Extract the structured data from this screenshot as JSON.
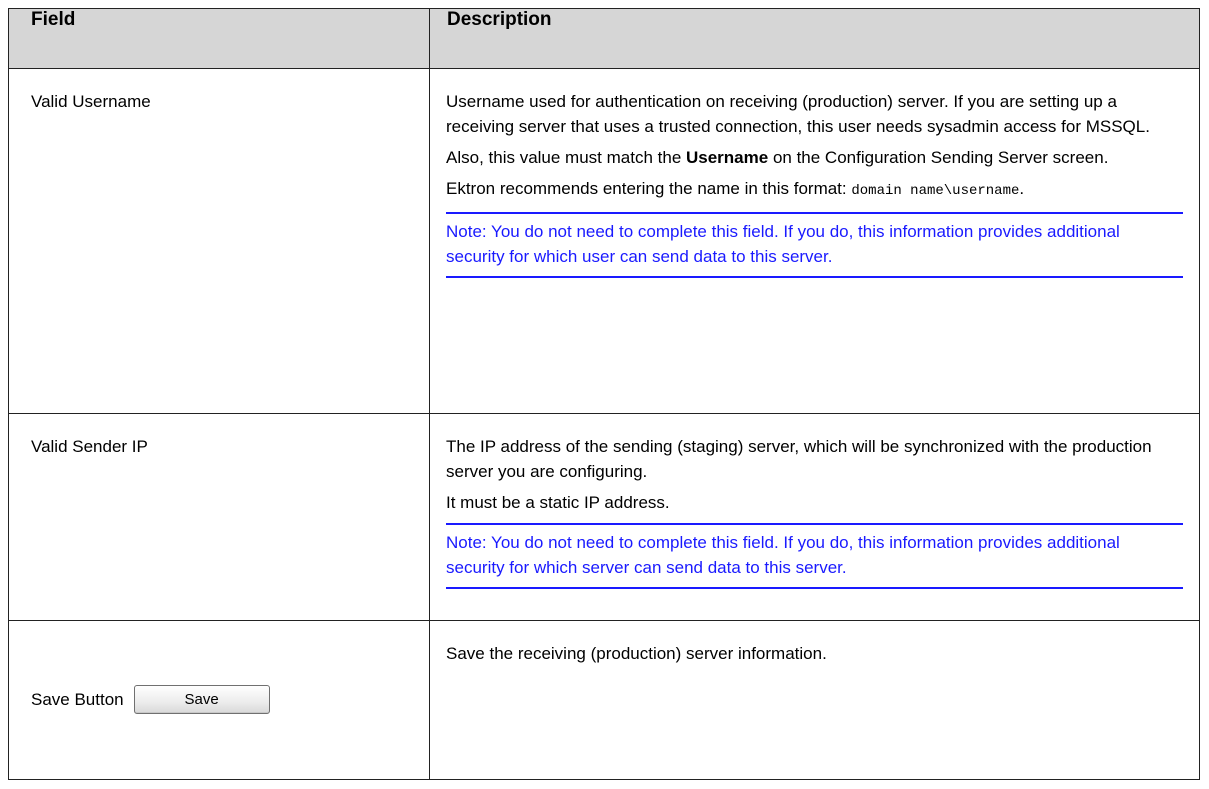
{
  "table": {
    "headers": {
      "field": "Field",
      "description": "Description"
    },
    "rows": {
      "username": {
        "field": "Valid Username",
        "p1": "Username used for authentication on receiving (production) server. If you are setting up a receiving server that uses a trusted connection, this user needs sysadmin access for MSSQL.",
        "p2_prefix": "Also, this value must match the ",
        "p2_bold": "Username",
        "p2_suffix": " on the Configuration Sending Server screen.",
        "p3_prefix": "Ektron recommends entering the name in this format: ",
        "p3_code": "domain name\\username",
        "p3_suffix": ".",
        "note": "Note: You do not need to complete this field. If you do, this information provides additional security for which user can send data to this server."
      },
      "sender_ip": {
        "field": "Valid Sender IP",
        "p1": "The IP address of the sending (staging) server, which will be synchronized with the production server you are configuring.",
        "p2": "It must be a static IP address.",
        "note": "Note: You do not need to complete this field. If you do, this information provides additional security for which server can send data to this server."
      },
      "save": {
        "field": "Save Button",
        "button_label": "Save",
        "description": "Save the receiving (production) server information."
      }
    }
  },
  "colors": {
    "header_bg": "#d6d6d6",
    "note_text": "#1a1aff",
    "border": "#222222"
  }
}
